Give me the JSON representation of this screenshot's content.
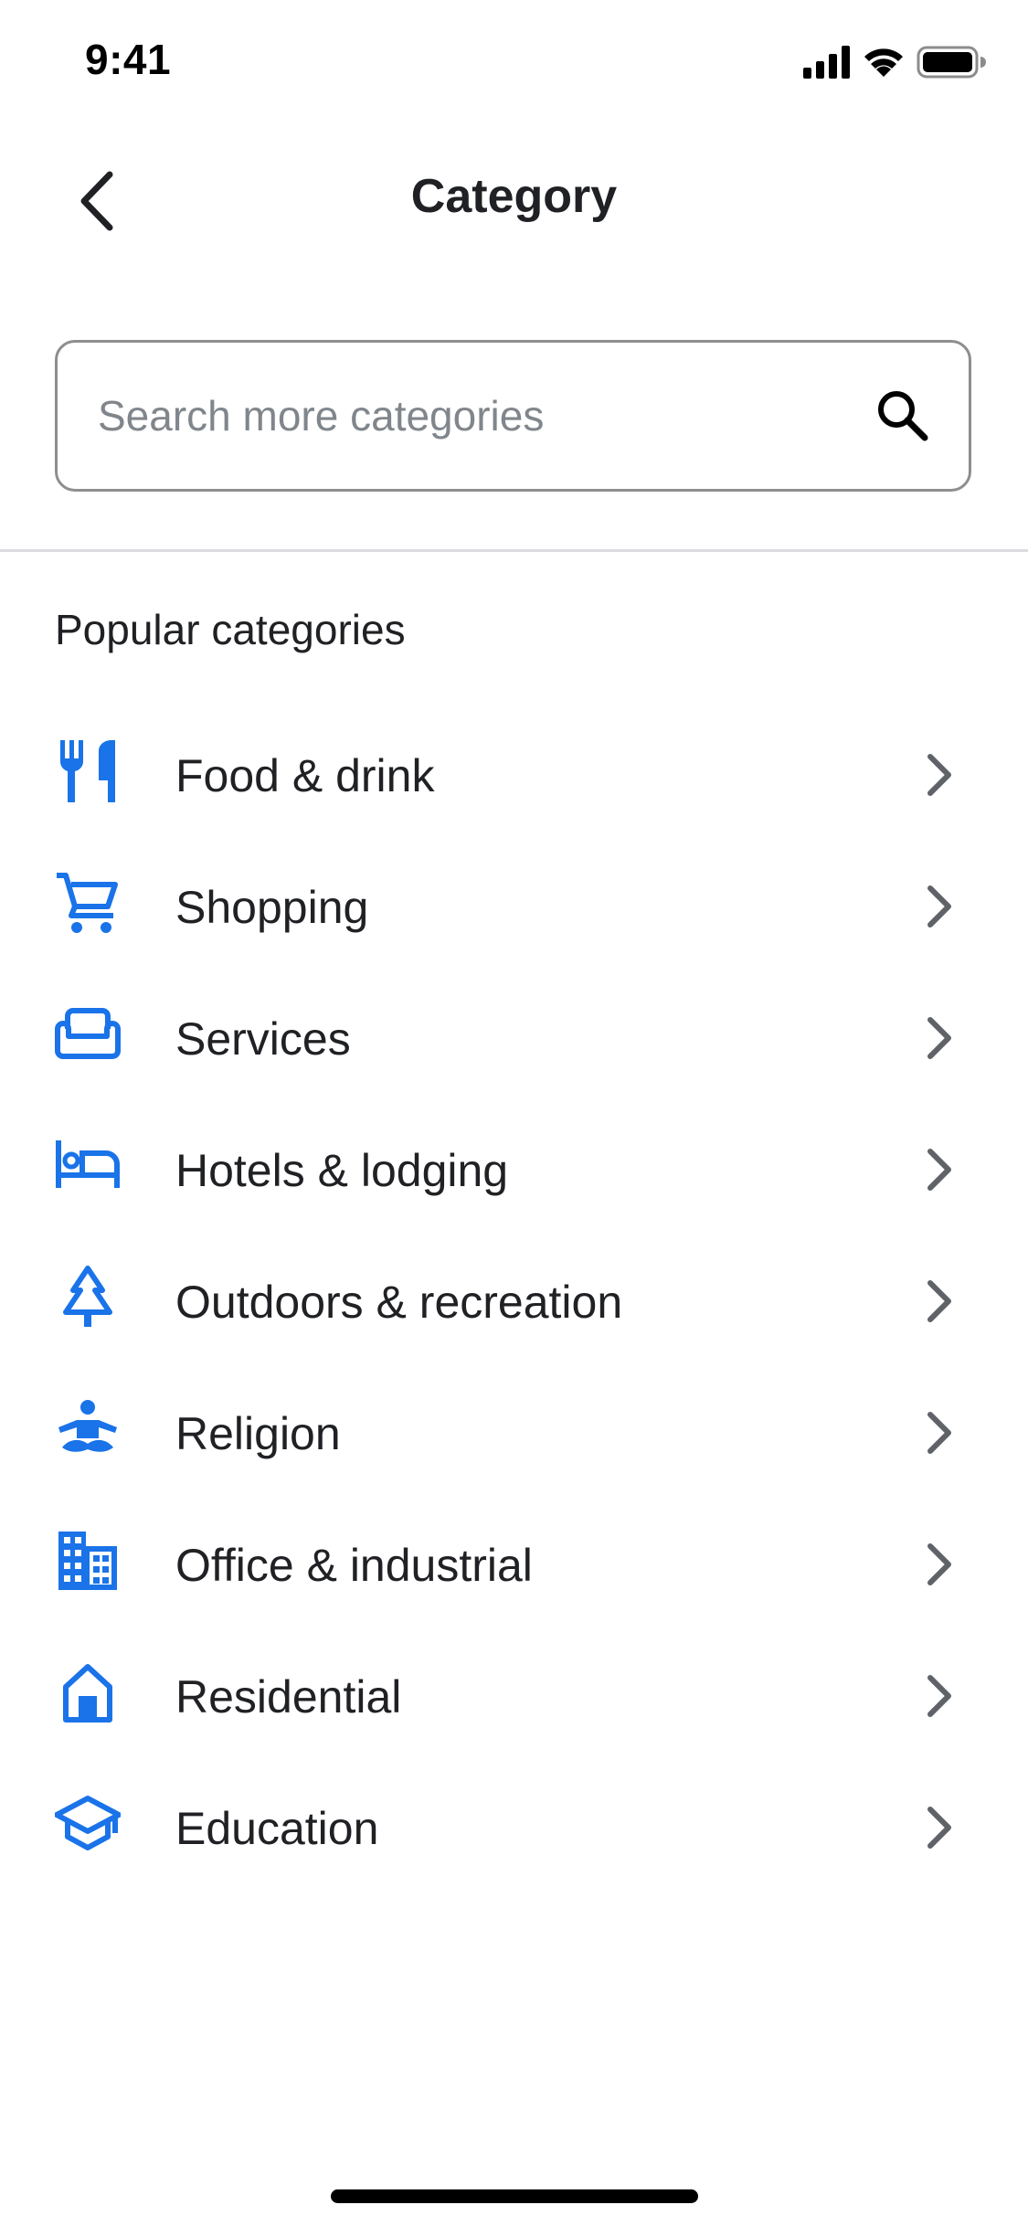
{
  "status_bar": {
    "time": "9:41"
  },
  "header": {
    "title": "Category",
    "back_icon": "back-arrow-icon"
  },
  "search": {
    "placeholder": "Search more categories",
    "value": "",
    "icon": "search-icon"
  },
  "section": {
    "title": "Popular categories"
  },
  "categories": [
    {
      "label": "Food & drink",
      "icon": "restaurant-icon"
    },
    {
      "label": "Shopping",
      "icon": "shopping-cart-icon"
    },
    {
      "label": "Services",
      "icon": "sofa-icon"
    },
    {
      "label": "Hotels & lodging",
      "icon": "hotel-bed-icon"
    },
    {
      "label": "Outdoors & recreation",
      "icon": "tree-icon"
    },
    {
      "label": "Religion",
      "icon": "meditation-icon"
    },
    {
      "label": "Office & industrial",
      "icon": "office-building-icon"
    },
    {
      "label": "Residential",
      "icon": "home-icon"
    },
    {
      "label": "Education",
      "icon": "graduation-cap-icon"
    }
  ],
  "colors": {
    "accent": "#1a73e8",
    "text": "#202124",
    "chevron": "#5f6368",
    "border": "#8e8e8e"
  }
}
